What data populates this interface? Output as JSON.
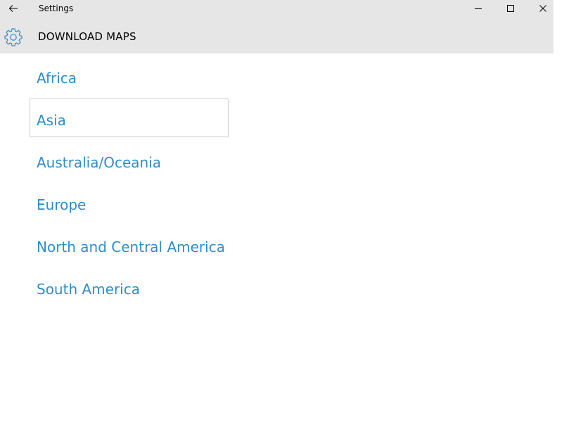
{
  "window": {
    "title": "Settings"
  },
  "header": {
    "title": "DOWNLOAD MAPS",
    "icon": "gear-icon"
  },
  "colors": {
    "accent": "#2f8ec8",
    "chrome": "#e6e6e6"
  },
  "regions": [
    {
      "label": "Africa"
    },
    {
      "label": "Asia"
    },
    {
      "label": "Australia/Oceania"
    },
    {
      "label": "Europe"
    },
    {
      "label": "North and Central America"
    },
    {
      "label": "South America"
    }
  ]
}
